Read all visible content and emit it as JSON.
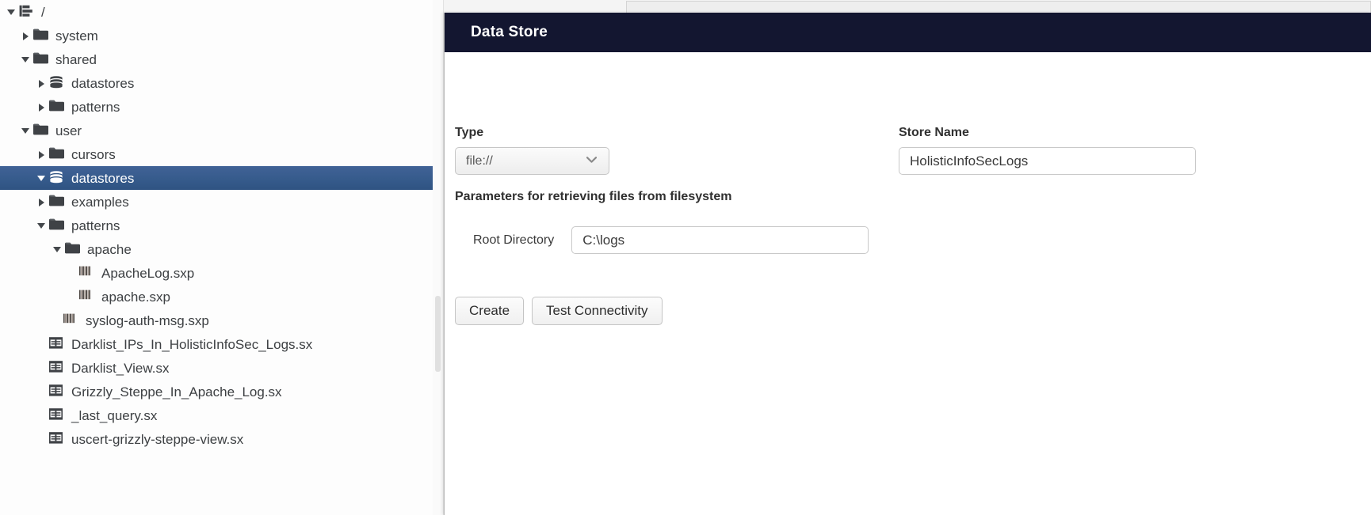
{
  "tree": {
    "items": [
      {
        "label": "/",
        "icon": "root-hierarchy-icon",
        "twisty": "expanded",
        "indent": "ind0",
        "selected": false
      },
      {
        "label": "system",
        "icon": "folder-icon",
        "twisty": "collapsed",
        "indent": "ind1",
        "selected": false
      },
      {
        "label": "shared",
        "icon": "folder-icon",
        "twisty": "expanded",
        "indent": "ind1",
        "selected": false
      },
      {
        "label": "datastores",
        "icon": "datastore-icon",
        "twisty": "collapsed",
        "indent": "ind2",
        "selected": false
      },
      {
        "label": "patterns",
        "icon": "folder-icon",
        "twisty": "collapsed",
        "indent": "ind2",
        "selected": false
      },
      {
        "label": "user",
        "icon": "folder-icon",
        "twisty": "expanded",
        "indent": "ind1",
        "selected": false
      },
      {
        "label": "cursors",
        "icon": "folder-icon",
        "twisty": "collapsed",
        "indent": "ind2",
        "selected": false
      },
      {
        "label": "datastores",
        "icon": "datastore-icon",
        "twisty": "expanded",
        "indent": "ind2",
        "selected": true
      },
      {
        "label": "examples",
        "icon": "folder-icon",
        "twisty": "collapsed",
        "indent": "ind2",
        "selected": false
      },
      {
        "label": "patterns",
        "icon": "folder-icon",
        "twisty": "expanded",
        "indent": "ind2",
        "selected": false
      },
      {
        "label": "apache",
        "icon": "folder-icon",
        "twisty": "expanded",
        "indent": "ind3",
        "selected": false
      },
      {
        "label": "ApacheLog.sxp",
        "icon": "pattern-file-icon",
        "twisty": "none",
        "indent": "ind-file3",
        "selected": false
      },
      {
        "label": "apache.sxp",
        "icon": "pattern-file-icon",
        "twisty": "none",
        "indent": "ind-file3",
        "selected": false
      },
      {
        "label": "syslog-auth-msg.sxp",
        "icon": "pattern-file-icon",
        "twisty": "none",
        "indent": "ind-file2",
        "selected": false
      },
      {
        "label": "Darklist_IPs_In_HolisticInfoSec_Logs.sx",
        "icon": "view-file-icon",
        "twisty": "none",
        "indent": "ind-sx",
        "selected": false
      },
      {
        "label": "Darklist_View.sx",
        "icon": "view-file-icon",
        "twisty": "none",
        "indent": "ind-sx",
        "selected": false
      },
      {
        "label": "Grizzly_Steppe_In_Apache_Log.sx",
        "icon": "view-file-icon",
        "twisty": "none",
        "indent": "ind-sx",
        "selected": false
      },
      {
        "label": "_last_query.sx",
        "icon": "view-file-icon",
        "twisty": "none",
        "indent": "ind-sx",
        "selected": false
      },
      {
        "label": "uscert-grizzly-steppe-view.sx",
        "icon": "view-file-icon",
        "twisty": "none",
        "indent": "ind-sx",
        "selected": false
      }
    ]
  },
  "panel": {
    "title": "Data Store",
    "type_label": "Type",
    "type_value": "file://",
    "type_options": [
      "file://"
    ],
    "params_note": "Parameters for retrieving files from filesystem",
    "store_name_label": "Store Name",
    "store_name_value": "HolisticInfoSecLogs",
    "root_directory_label": "Root Directory",
    "root_directory_value": "C:\\logs",
    "create_label": "Create",
    "test_connectivity_label": "Test Connectivity"
  },
  "colors": {
    "header_navy": "#131630",
    "selection_blue": "#365b8c",
    "text_dark": "#3d4043"
  }
}
